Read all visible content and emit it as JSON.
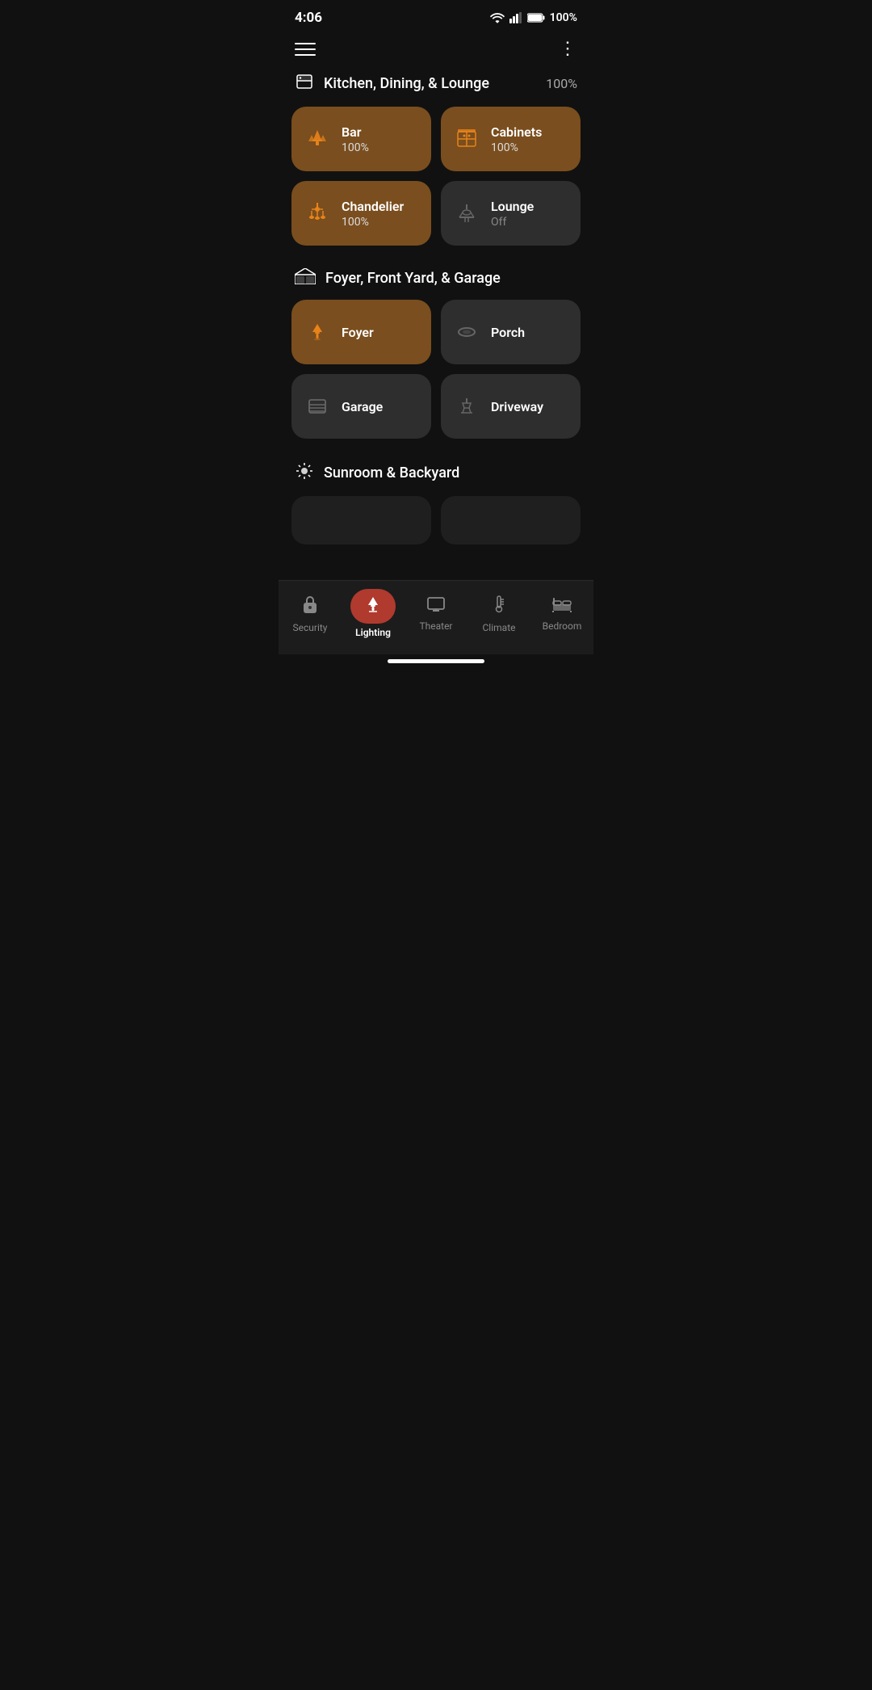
{
  "statusBar": {
    "time": "4:06",
    "battery": "100%"
  },
  "topBar": {
    "menuLabel": "Menu",
    "moreLabel": "More options"
  },
  "sections": [
    {
      "id": "kitchen",
      "icon": "fridge",
      "title": "Kitchen, Dining, & Lounge",
      "percentage": "100%",
      "cards": [
        {
          "id": "bar",
          "name": "Bar",
          "status": "100%",
          "state": "on",
          "icon": "pendant"
        },
        {
          "id": "cabinets",
          "name": "Cabinets",
          "status": "100%",
          "state": "on",
          "icon": "cabinet"
        },
        {
          "id": "chandelier",
          "name": "Chandelier",
          "status": "100%",
          "state": "on",
          "icon": "chandelier"
        },
        {
          "id": "lounge",
          "name": "Lounge",
          "status": "Off",
          "state": "off",
          "icon": "floor-lamp"
        }
      ]
    },
    {
      "id": "foyer",
      "icon": "sofa",
      "title": "Foyer, Front Yard, & Garage",
      "percentage": "",
      "cards": [
        {
          "id": "foyer",
          "name": "Foyer",
          "status": "",
          "state": "on",
          "icon": "ceiling-light"
        },
        {
          "id": "porch",
          "name": "Porch",
          "status": "",
          "state": "off",
          "icon": "porch-light"
        },
        {
          "id": "garage",
          "name": "Garage",
          "status": "",
          "state": "off",
          "icon": "garage"
        },
        {
          "id": "driveway",
          "name": "Driveway",
          "status": "",
          "state": "off",
          "icon": "driveway-light"
        }
      ]
    },
    {
      "id": "sunroom",
      "icon": "sun",
      "title": "Sunroom & Backyard",
      "percentage": "",
      "cards": []
    }
  ],
  "bottomNav": {
    "items": [
      {
        "id": "security",
        "label": "Security",
        "icon": "lock",
        "active": false
      },
      {
        "id": "lighting",
        "label": "Lighting",
        "icon": "lamp",
        "active": true
      },
      {
        "id": "theater",
        "label": "Theater",
        "icon": "tv",
        "active": false
      },
      {
        "id": "climate",
        "label": "Climate",
        "icon": "thermometer",
        "active": false
      },
      {
        "id": "bedroom",
        "label": "Bedroom",
        "icon": "bed",
        "active": false
      }
    ]
  }
}
